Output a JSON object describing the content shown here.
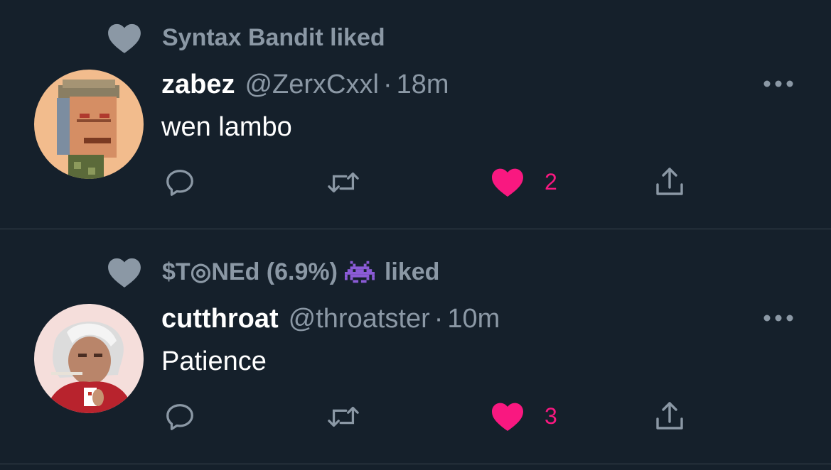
{
  "tweets": [
    {
      "liked_by": "Syntax Bandit liked",
      "display_name": "zabez",
      "handle": "@ZerxCxxl",
      "separator": "·",
      "time": "18m",
      "text": "wen lambo",
      "like_count": "2"
    },
    {
      "liked_by_name": "$T◎NEd (6.9%)",
      "liked_by_suffix": "liked",
      "display_name": "cutthroat",
      "handle": "@throatster",
      "separator": "·",
      "time": "10m",
      "text": "Patience",
      "like_count": "3"
    }
  ],
  "icons": {
    "social_context": "heart-icon",
    "more": "more-horizontal-icon",
    "reply": "reply-icon",
    "retweet": "retweet-icon",
    "like": "heart-filled-icon",
    "share": "share-icon",
    "alien": "space-invader-icon"
  },
  "colors": {
    "background": "#15202b",
    "muted": "#8b98a5",
    "like_pink": "#f91880",
    "divider": "#38444d"
  }
}
